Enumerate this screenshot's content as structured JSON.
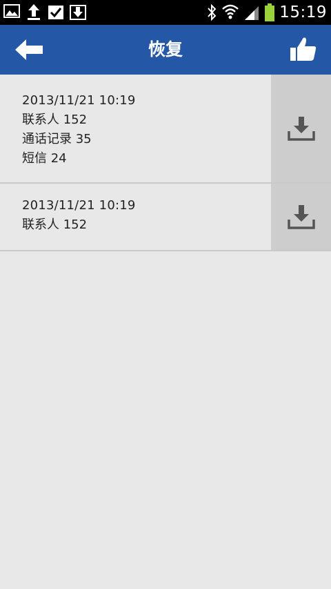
{
  "status_bar": {
    "time": "15:19",
    "left_icons": [
      "gallery-icon",
      "upload-icon",
      "checked-clipboard-icon",
      "download-box-icon"
    ],
    "right_icons": [
      "bluetooth-icon",
      "wifi-icon",
      "signal-icon",
      "battery-icon"
    ]
  },
  "header": {
    "title": "恢复",
    "back_icon": "back-arrow-icon",
    "like_icon": "thumbs-up-icon",
    "background": "#2457a6"
  },
  "backups": [
    {
      "datetime": "2013/11/21  10:19",
      "lines": [
        "联系人 152",
        "通话记录 35",
        "短信 24"
      ]
    },
    {
      "datetime": "2013/11/21  10:19",
      "lines": [
        "联系人 152"
      ]
    }
  ],
  "actions": {
    "restore_icon": "download-icon"
  }
}
